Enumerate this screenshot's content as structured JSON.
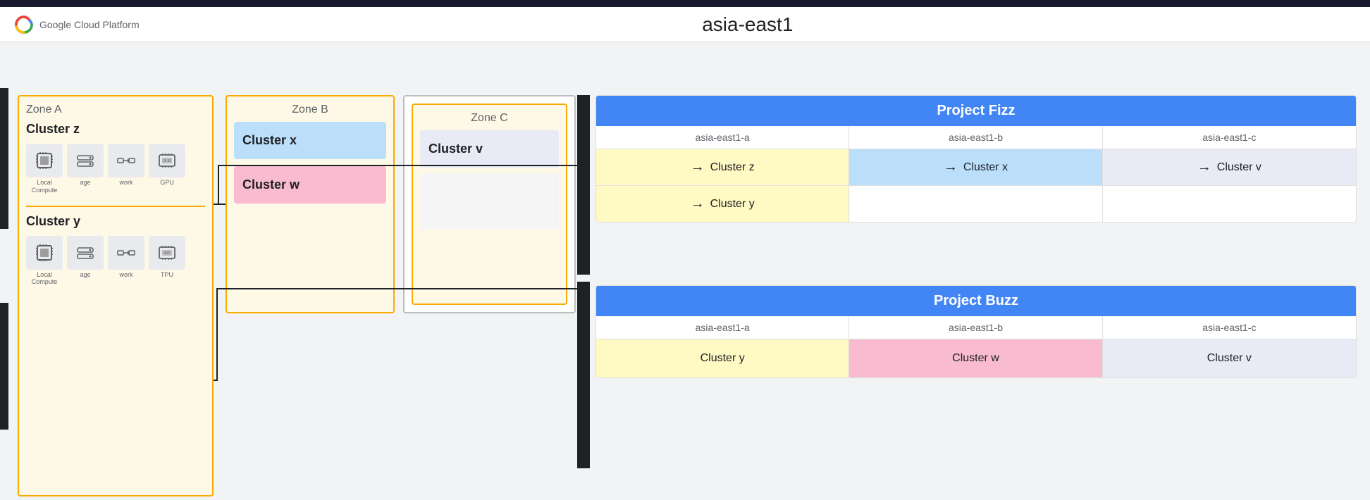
{
  "header": {
    "logo_text": "Google Cloud Platform",
    "main_title": "asia-east1"
  },
  "zones": {
    "zone_a": {
      "label": "Zone A",
      "cluster_z": {
        "label": "Cluster z",
        "icons": [
          {
            "name": "Local Compute",
            "type": "compute"
          },
          {
            "name": "age",
            "type": "storage"
          },
          {
            "name": "work",
            "type": "network"
          },
          {
            "name": "GPU",
            "type": "gpu"
          }
        ]
      },
      "cluster_y": {
        "label": "Cluster y",
        "icons": [
          {
            "name": "Local Compute",
            "type": "compute"
          },
          {
            "name": "age",
            "type": "storage"
          },
          {
            "name": "work",
            "type": "network"
          },
          {
            "name": "TPU",
            "type": "tpu"
          }
        ]
      }
    },
    "zone_b": {
      "label": "Zone B",
      "cluster_x": {
        "label": "Cluster x",
        "bg": "blue"
      },
      "cluster_w": {
        "label": "Cluster w",
        "bg": "pink"
      }
    },
    "zone_c": {
      "label": "Zone C",
      "cluster_v": {
        "label": "Cluster v",
        "bg": "none"
      }
    }
  },
  "projects": {
    "fizz": {
      "title": "Project Fizz",
      "zones": [
        "asia-east1-a",
        "asia-east1-b",
        "asia-east1-c"
      ],
      "clusters_row1": [
        {
          "label": "Cluster z",
          "style": "yellow"
        },
        {
          "label": "Cluster x",
          "style": "blue"
        },
        {
          "label": "Cluster v",
          "style": "purple"
        }
      ],
      "clusters_row2": [
        {
          "label": "Cluster y",
          "style": "yellow"
        },
        {
          "label": "",
          "style": "empty"
        },
        {
          "label": "",
          "style": "empty"
        }
      ],
      "arrows": [
        {
          "from": "z",
          "to": "x"
        },
        {
          "from": "x",
          "to": "v"
        }
      ]
    },
    "buzz": {
      "title": "Project Buzz",
      "zones": [
        "asia-east1-a",
        "asia-east1-b",
        "asia-east1-c"
      ],
      "clusters": [
        {
          "label": "Cluster y",
          "style": "yellow"
        },
        {
          "label": "Cluster w",
          "style": "pink"
        },
        {
          "label": "Cluster v",
          "style": "purple"
        }
      ]
    }
  }
}
